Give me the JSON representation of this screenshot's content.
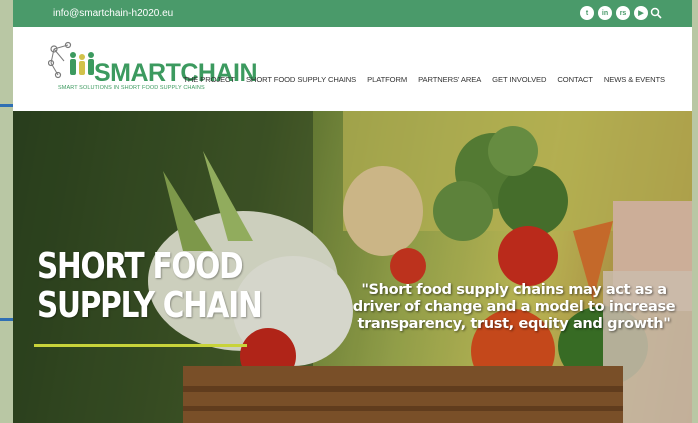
{
  "topbar": {
    "email": "info@smartchain-h2020.eu",
    "social": [
      {
        "icon": "twitter-icon",
        "glyph": "t"
      },
      {
        "icon": "linkedin-icon",
        "glyph": "in"
      },
      {
        "icon": "rss-icon",
        "glyph": "rs"
      },
      {
        "icon": "youtube-icon",
        "glyph": "▶"
      }
    ],
    "search_icon": "search-icon",
    "color": "#4a9a6a"
  },
  "logo": {
    "name": "SMARTCHAIN",
    "tagline": "SMART SOLUTIONS IN SHORT FOOD SUPPLY CHAINS",
    "color": "#3c9a5f"
  },
  "nav": {
    "items": [
      "THE PROJECT",
      "SHORT FOOD SUPPLY CHAINS",
      "PLATFORM",
      "PARTNERS' AREA",
      "GET INVOLVED",
      "CONTACT",
      "NEWS & EVENTS"
    ]
  },
  "hero": {
    "title_line1": "SHORT FOOD",
    "title_line2": "SUPPLY CHAIN",
    "quote": "\"Short food supply chains may act as a driver of change and a model to increase transparency, trust, equity and growth\"",
    "accent_color": "#c8d33a"
  }
}
